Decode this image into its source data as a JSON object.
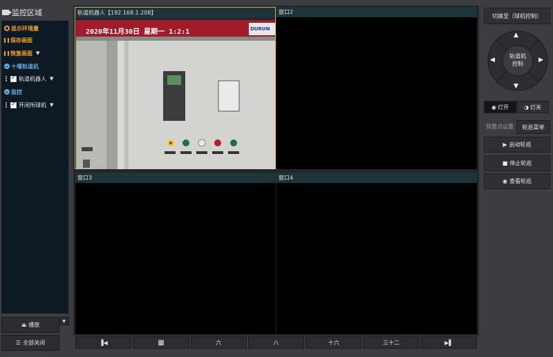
{
  "left_panel": {
    "title": "监控区域",
    "tree": [
      {
        "label": "显示环境量",
        "style": "orange",
        "icon": "gear-icon"
      },
      {
        "label": "保存画面",
        "style": "orange",
        "icon": "bars-icon"
      },
      {
        "label": "恢复画面",
        "style": "orange",
        "icon": "bars-icon",
        "dropdown": true
      },
      {
        "label": "十堰轨道机",
        "style": "blue",
        "icon": "collapse-icon"
      },
      {
        "label": "轨道机器人",
        "style": "white",
        "checkbox": true,
        "dropdown": true
      },
      {
        "label": "监控",
        "style": "blue",
        "icon": "collapse-icon"
      },
      {
        "label": "开闭所球机",
        "style": "white",
        "checkbox": true,
        "dropdown": true
      }
    ],
    "play_button": "播放",
    "close_all_button": "全部关闭"
  },
  "video": {
    "windows": [
      {
        "title": "轨道机器人【192.168.1.208】",
        "active": true
      },
      {
        "title": "窗口2"
      },
      {
        "title": "窗口3"
      },
      {
        "title": "窗口4"
      }
    ],
    "osd_text": "2020年11月30日  星期一  1:2:1",
    "brand_text": "DURUN",
    "layout_buttons": [
      "",
      "",
      "六",
      "八",
      "十六",
      "三十二",
      ""
    ]
  },
  "right_panel": {
    "switch_button": "切换至（球机控制）",
    "ptz_label_line1": "轨道机",
    "ptz_label_line2": "控制",
    "light_on": "灯开",
    "light_off": "灯关",
    "tab_preset": "预置点设置",
    "tab_patrol": "轮巡菜单",
    "start_patrol": "启动轮巡",
    "stop_patrol": "停止轮巡",
    "view_patrol": "查看轮巡"
  }
}
